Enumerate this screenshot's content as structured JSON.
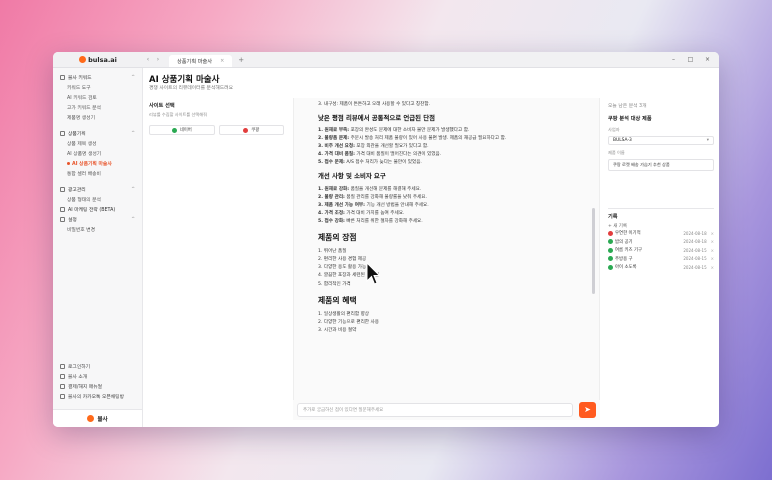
{
  "app": {
    "logo": "bulsa.ai",
    "tab_title": "상품기획 마술사",
    "tab_close": "×",
    "new_tab": "+",
    "nav_back": "‹",
    "nav_forward": "›",
    "window_controls": [
      "–",
      "□",
      "×"
    ]
  },
  "sidebar": {
    "groups": [
      {
        "label": "블사 키워드",
        "chevron": "^",
        "items": [
          {
            "label": "키워드 도구",
            "active": false
          },
          {
            "label": "AI 키워드 검토",
            "active": false
          },
          {
            "label": "고가 키워드 분석",
            "active": false
          },
          {
            "label": "제품명 생성기",
            "active": false
          }
        ]
      },
      {
        "label": "상품기획",
        "chevron": "^",
        "items": [
          {
            "label": "상품 제목 생성",
            "active": false
          },
          {
            "label": "AI 상품명 생성기",
            "active": false
          },
          {
            "label": "AI 상품기획 마술사",
            "active": true
          },
          {
            "label": "통합 셀러 배송비",
            "active": false
          }
        ]
      },
      {
        "label": "광고관리",
        "chevron": "^",
        "items": [
          {
            "label": "상품 형태의 분석",
            "active": false
          }
        ]
      },
      {
        "label": "AI 마케팅 전략 (BETA)",
        "chevron": "",
        "items": []
      },
      {
        "label": "설정",
        "chevron": "^",
        "items": [
          {
            "label": "비밀번호 변경",
            "active": false
          }
        ]
      }
    ],
    "bottom": [
      "로그인하기",
      "블사 소개",
      "결제/해지 매뉴얼",
      "블사의 카카오톡 오픈채팅방"
    ],
    "footer": "블사"
  },
  "main": {
    "title": "AI 상품기획 마술사",
    "subtitle": "경쟁 사이트의 리뷰데이터를 분석해드려요",
    "left": {
      "title": "사이트 선택",
      "desc": "리뷰를 수집할 사이트를 선택해줘",
      "options": [
        {
          "label": "네이버",
          "color": "#2aa952"
        },
        {
          "label": "쿠팡",
          "color": "#e23d3d"
        }
      ]
    },
    "doc": {
      "top_line": "3. 내구성: 제품이 튼튼하고 오래 사용할 수 있다고 칭찬함.",
      "sections": [
        {
          "heading": "낮은 평점 리뷰에서 공통적으로 언급된 단점",
          "level": "h2",
          "items": [
            {
              "label": "1. 원재료 부족:",
              "text": "포장의 완성도 문제에 대한 소비자 불만 문제가 발생했다고 함."
            },
            {
              "label": "2. 불량품 문제:",
              "text": "주문시 발송 처리 제품 불량이 있어 사용 불편 발생. 제품의 재공급 필요하다고 함."
            },
            {
              "label": "3. 비주 개선 요청:",
              "text": "포장 외관을 개선할 필요가 있다고 함."
            },
            {
              "label": "4. 가격 대비 품질:",
              "text": "가격 대비 품질이 떨어진다는 의견이 있었음."
            },
            {
              "label": "5. 접수 문제:",
              "text": "A/S 접수 처리가 늦다는 불만이 있었음."
            }
          ]
        },
        {
          "heading": "개선 사항 및 소비자 요구",
          "level": "h2",
          "items": [
            {
              "label": "1. 원재료 강화:",
              "text": "품질을 개선해 문제를 해결해 주세요."
            },
            {
              "label": "2. 불량 관리:",
              "text": "품질 관리를 강화해 불량률을 낮춰 주세요."
            },
            {
              "label": "3. 제품 개선 가능 여부:",
              "text": "기능 개선 방법을 안내해 주세요."
            },
            {
              "label": "4. 가격 조정:",
              "text": "가격 대비 가치를 높여 주세요."
            },
            {
              "label": "5. 접수 강화:",
              "text": "빠른 처리를 위한 절차를 강화해 주세요."
            }
          ]
        },
        {
          "heading": "제품의 장점",
          "level": "h3",
          "items": [
            {
              "label": "",
              "text": "1. 뛰어난 품질"
            },
            {
              "label": "",
              "text": "2. 편리한 사용 경험 제공"
            },
            {
              "label": "",
              "text": "3. 다양한 용도 활용 가능"
            },
            {
              "label": "",
              "text": "4. 깔끔한 포장과 세련된 디자인"
            },
            {
              "label": "",
              "text": "5. 합리적인 가격"
            }
          ]
        },
        {
          "heading": "제품의 혜택",
          "level": "h3",
          "items": [
            {
              "label": "",
              "text": "1. 일상생활의 편리함 향상"
            },
            {
              "label": "",
              "text": "2. 다양한 기능으로 편리한 사용"
            },
            {
              "label": "",
              "text": "3. 시간과 비용 절약"
            }
          ]
        }
      ]
    },
    "input": {
      "placeholder": "추가로 궁금하신 점이 있다면 질문해주세요",
      "send": "➤"
    },
    "right": {
      "top": "오늘 남은 분석 3개",
      "sub": "쿠팡 분석 대상 제품",
      "field_label": "사업자",
      "select_value": "BULSA-3",
      "select_chevron": "▾",
      "text_label": "제품 이름",
      "text_value": "쿠팡 로켓 배송 가습기 추천 상품",
      "history_title": "기록",
      "history_new": "+ 새 기록",
      "history": [
        {
          "name": "우연한 이기적",
          "date": "2024-08-18",
          "color": "red"
        },
        {
          "name": "밤의 공기",
          "date": "2024-08-18",
          "color": "green"
        },
        {
          "name": "여름 키즈 기구",
          "date": "2024-08-15",
          "color": "green"
        },
        {
          "name": "주방용 구",
          "date": "2024-08-15",
          "color": "green"
        },
        {
          "name": "아이 소도록",
          "date": "2024-08-15",
          "color": "green"
        }
      ],
      "close": "×"
    }
  }
}
